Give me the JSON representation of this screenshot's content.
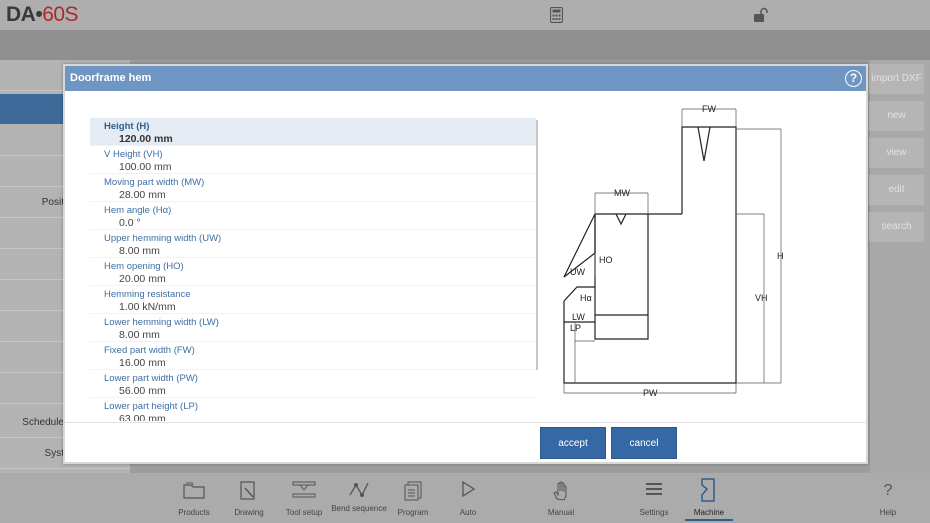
{
  "app": {
    "logo_main": "DA",
    "logo_dot": "•",
    "logo_model": "60S"
  },
  "left_column": {
    "rows": [
      "Posit",
      "Schedule",
      "Syst"
    ]
  },
  "right_buttons": [
    {
      "label": "import DXF"
    },
    {
      "label": "new"
    },
    {
      "label": "view"
    },
    {
      "label": "edit"
    },
    {
      "label": "search"
    }
  ],
  "dialog": {
    "title": "Doorframe hem",
    "help": "?",
    "parameters": [
      {
        "label": "Height (H)",
        "value": "120.00 mm",
        "selected": true
      },
      {
        "label": "V Height (VH)",
        "value": "100.00 mm"
      },
      {
        "label": "Moving part width (MW)",
        "value": "28.00 mm"
      },
      {
        "label": "Hem angle (Hα)",
        "value": "0.0 °"
      },
      {
        "label": "Upper hemming width (UW)",
        "value": "8.00 mm"
      },
      {
        "label": "Hem opening (HO)",
        "value": "20.00 mm"
      },
      {
        "label": "Hemming resistance",
        "value": "1.00 kN/mm"
      },
      {
        "label": "Lower hemming width (LW)",
        "value": "8.00 mm"
      },
      {
        "label": "Fixed part width (FW)",
        "value": "16.00 mm"
      },
      {
        "label": "Lower part width (PW)",
        "value": "56.00 mm"
      },
      {
        "label": "Lower part height (LP)",
        "value": "63.00 mm"
      }
    ],
    "diagram_labels": {
      "fw": "FW",
      "mw": "MW",
      "ho": "HO",
      "uw": "UW",
      "ha": "Hα",
      "lw": "LW",
      "lp": "LP",
      "h": "H",
      "vh": "VH",
      "pw": "PW"
    },
    "accept_label": "accept",
    "cancel_label": "cancel"
  },
  "bottom_nav": [
    {
      "label": "Products",
      "icon": "folder-icon"
    },
    {
      "label": "Drawing",
      "icon": "drawing-icon"
    },
    {
      "label": "Tool setup",
      "icon": "tool-setup-icon"
    },
    {
      "label": "Bend sequence",
      "icon": "bend-sequence-icon"
    },
    {
      "label": "Program",
      "icon": "program-icon"
    },
    {
      "label": "Auto",
      "icon": "play-icon"
    },
    {
      "label": "Manual",
      "icon": "hand-icon"
    },
    {
      "label": "Settings",
      "icon": "settings-list-icon"
    },
    {
      "label": "Machine",
      "icon": "machine-icon",
      "active": true
    },
    {
      "label": "Help",
      "icon": "help-question-icon"
    }
  ],
  "colors": {
    "accent": "#3568a4",
    "title_bar": "#6f95c2",
    "logo_model": "#b0282d"
  }
}
